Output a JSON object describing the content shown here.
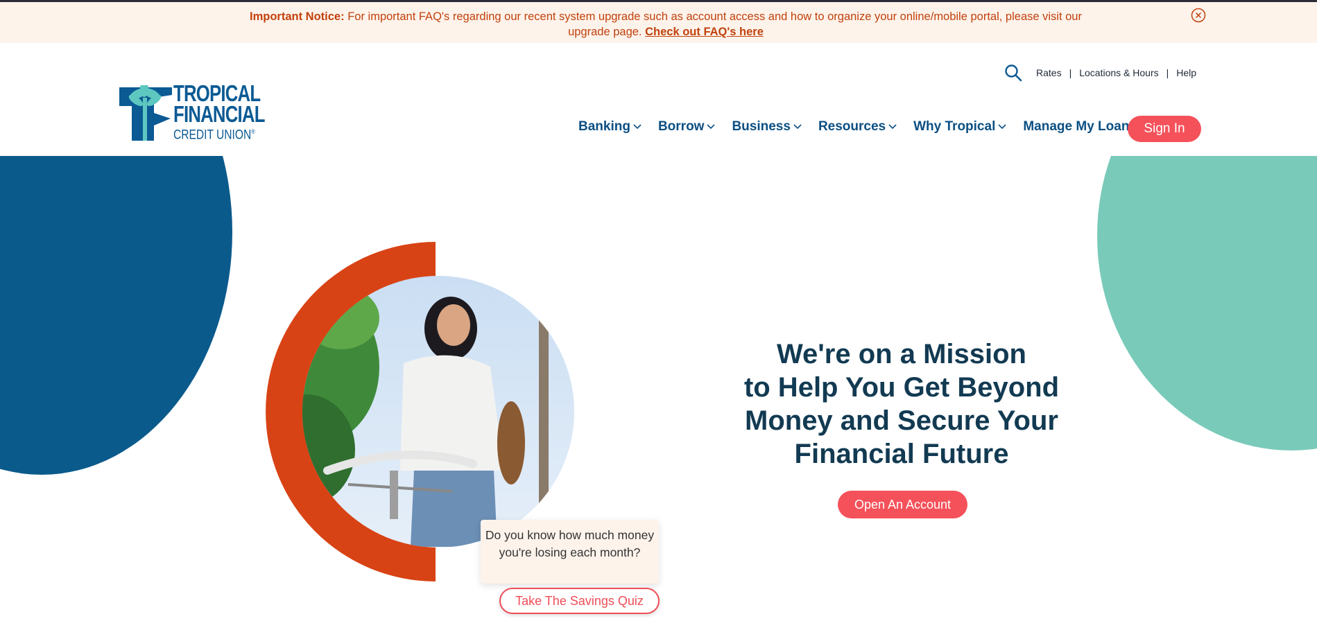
{
  "notice": {
    "label": "Important Notice:",
    "text": " For important FAQ's regarding our recent system upgrade such as account access and how to organize your online/mobile portal, please visit our upgrade page. ",
    "link": "Check out FAQ's here"
  },
  "logo": {
    "line1": "TROPICAL",
    "line2": "FINANCIAL",
    "line3": "CREDIT UNION",
    "registered": "®"
  },
  "utility": {
    "icon": "search-icon",
    "links": [
      "Rates",
      "Locations & Hours",
      "Help"
    ],
    "separator": "|"
  },
  "nav": {
    "items": [
      {
        "label": "Banking",
        "dropdown": true
      },
      {
        "label": "Borrow",
        "dropdown": true
      },
      {
        "label": "Business",
        "dropdown": true
      },
      {
        "label": "Resources",
        "dropdown": true
      },
      {
        "label": "Why Tropical",
        "dropdown": true
      },
      {
        "label": "Manage My Loan",
        "dropdown": false
      }
    ],
    "signin_label": "Sign In"
  },
  "hero": {
    "headline_lines": [
      "We're on a Mission",
      "to Help You Get Beyond",
      "Money and Secure Your",
      "Financial Future"
    ],
    "cta_label": "Open An Account",
    "quiz_text": "Do you know how much money you're losing each month?",
    "quiz_button": "Take The Savings Quiz"
  },
  "colors": {
    "brand_blue": "#0b5a8c",
    "teal": "#79cab9",
    "coral": "#f4515a",
    "orange_ring": "#d84315",
    "notice_bg": "#fdf3eb",
    "notice_text": "#c2410c"
  }
}
